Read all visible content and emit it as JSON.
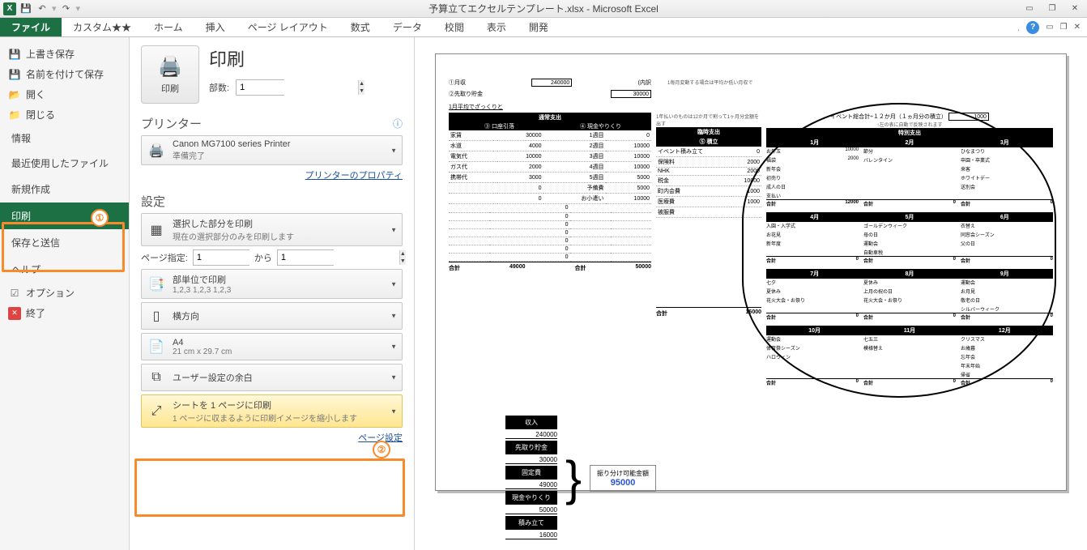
{
  "titlebar": {
    "title": "予算立てエクセルテンプレート.xlsx - Microsoft Excel"
  },
  "ribbon": {
    "file": "ファイル",
    "tabs": [
      "カスタム★★",
      "ホーム",
      "挿入",
      "ページ レイアウト",
      "数式",
      "データ",
      "校閲",
      "表示",
      "開発"
    ]
  },
  "sidebar": {
    "save": "上書き保存",
    "saveas": "名前を付けて保存",
    "open": "開く",
    "close": "閉じる",
    "info": "情報",
    "recent": "最近使用したファイル",
    "new": "新規作成",
    "print": "印刷",
    "share": "保存と送信",
    "help": "ヘルプ",
    "options": "オプション",
    "exit": "終了"
  },
  "settings": {
    "print_title": "印刷",
    "print_btn": "印刷",
    "copies_label": "部数:",
    "copies_value": "1",
    "printer_section": "プリンター",
    "printer_name": "Canon MG7100 series Printer",
    "printer_status": "準備完了",
    "printer_props": "プリンターのプロパティ",
    "settings_section": "設定",
    "print_area_title": "選択した部分を印刷",
    "print_area_sub": "現在の選択部分のみを印刷します",
    "pages_label": "ページ指定:",
    "pages_from": "1",
    "pages_to_label": "から",
    "pages_to": "1",
    "collate_title": "部単位で印刷",
    "collate_sub": "1,2,3   1,2,3   1,2,3",
    "orient": "横方向",
    "paper_title": "A4",
    "paper_sub": "21 cm x 29.7 cm",
    "margins": "ユーザー設定の余白",
    "scale_title": "シートを 1 ページに印刷",
    "scale_sub": "1 ページに収まるように印刷イメージを縮小します",
    "page_setup": "ページ設定"
  },
  "preview": {
    "income_label": "①月収",
    "income_note": "1毎月変動する場合は平均か低い月収で",
    "income_val": "240000",
    "income_uchi": "(内訳",
    "savings_label": "②先取り貯金",
    "savings_val": "30000",
    "rough_title": "1月平均でざっくりと",
    "left_header": "通常支出",
    "left_sub1": "③ 口座引落",
    "left_sub2": "④ 現金やりくり",
    "left_rows": [
      [
        "家賃",
        "30000",
        "1週目",
        "0"
      ],
      [
        "水道",
        "4000",
        "2週目",
        "10000"
      ],
      [
        "電気代",
        "10000",
        "3週目",
        "10000"
      ],
      [
        "ガス代",
        "2000",
        "4週目",
        "10000"
      ],
      [
        "携帯代",
        "3000",
        "5週目",
        "5000"
      ],
      [
        "",
        "0",
        "予備費",
        "5000"
      ],
      [
        "",
        "0",
        "お小遣い",
        "10000"
      ]
    ],
    "left_total_l": "合計",
    "left_total_lv": "49000",
    "left_total_r": "合計",
    "left_total_rv": "50000",
    "mid_note": "1年払いのものは12か月で割って1ヶ月分金額を出す",
    "mid_header": "臨時支出",
    "mid_sub": "⑤ 積立",
    "mid_rows": [
      [
        "イベント積み立て",
        "0"
      ],
      [
        "保険料",
        "2000"
      ],
      [
        "NHK",
        "2000"
      ],
      [
        "税金",
        "10000"
      ],
      [
        "町内会費",
        "1000"
      ],
      [
        "医療費",
        "1000"
      ],
      [
        "被服費",
        ""
      ]
    ],
    "mid_total": "合計",
    "mid_total_v": "16000",
    "summary": {
      "items": [
        [
          "収入",
          "240000"
        ],
        [
          "先取り貯金",
          "30000"
        ],
        [
          "固定費",
          "49000"
        ],
        [
          "現金やりくり",
          "50000"
        ],
        [
          "積み立て",
          "16000"
        ]
      ],
      "result_label": "振り分け可能金額",
      "result_value": "95000"
    },
    "events": {
      "title": "イベント総合計÷１２か月（１ヵ月分の積立）",
      "title_val": "1000",
      "note": "↑左の表に自動で反映されます",
      "special_header": "特別支出",
      "blocks": [
        {
          "months": [
            "1月",
            "2月",
            "3月"
          ],
          "rows": [
            [
              "お年玉",
              "10000",
              "節分",
              "",
              "ひなまつり",
              ""
            ],
            [
              "福袋",
              "2000",
              "バレンタイン",
              "",
              "卒園・卒業式",
              ""
            ],
            [
              "新年会",
              "",
              "",
              "",
              "来客",
              ""
            ],
            [
              "初売り",
              "",
              "",
              "",
              "ホワイトデー",
              ""
            ],
            [
              "成人の日",
              "",
              "",
              "",
              "送別会",
              ""
            ],
            [
              "支払い",
              "",
              "",
              "",
              "",
              "",
              ""
            ]
          ],
          "totals": [
            "12000",
            "0",
            "0"
          ]
        },
        {
          "months": [
            "4月",
            "5月",
            "6月"
          ],
          "rows": [
            [
              "入園・入学式",
              "",
              "ゴールデンウィーク",
              "",
              "衣替え",
              ""
            ],
            [
              "お花見",
              "",
              "母の日",
              "",
              "同窓会シーズン",
              ""
            ],
            [
              "新年度",
              "",
              "運動会",
              "",
              "父の日",
              ""
            ],
            [
              "",
              "",
              "自動車税",
              "",
              "",
              ""
            ]
          ],
          "totals": [
            "0",
            "0",
            "0"
          ]
        },
        {
          "months": [
            "7月",
            "8月",
            "9月"
          ],
          "rows": [
            [
              "七夕",
              "",
              "夏休み",
              "",
              "運動会",
              ""
            ],
            [
              "夏休み",
              "",
              "上月の祝の日",
              "",
              "お月見",
              ""
            ],
            [
              "花火大会・お祭り",
              "",
              "花火大会・お祭り",
              "",
              "敬老の日",
              ""
            ],
            [
              "",
              "",
              "",
              "",
              "シルバーウィーク",
              ""
            ]
          ],
          "totals": [
            "0",
            "0",
            "0"
          ]
        },
        {
          "months": [
            "10月",
            "11月",
            "12月"
          ],
          "rows": [
            [
              "運動会",
              "",
              "七五三",
              "",
              "クリスマス",
              ""
            ],
            [
              "体育祭シーズン",
              "",
              "模様替え",
              "",
              "お歳暮",
              ""
            ],
            [
              "ハロウィン",
              "",
              "",
              "",
              "忘年会",
              ""
            ],
            [
              "",
              "",
              "",
              "",
              "年末年始",
              ""
            ],
            [
              "",
              "",
              "",
              "",
              "帰省",
              ""
            ]
          ],
          "totals": [
            "0",
            "0",
            "0"
          ]
        }
      ]
    }
  }
}
